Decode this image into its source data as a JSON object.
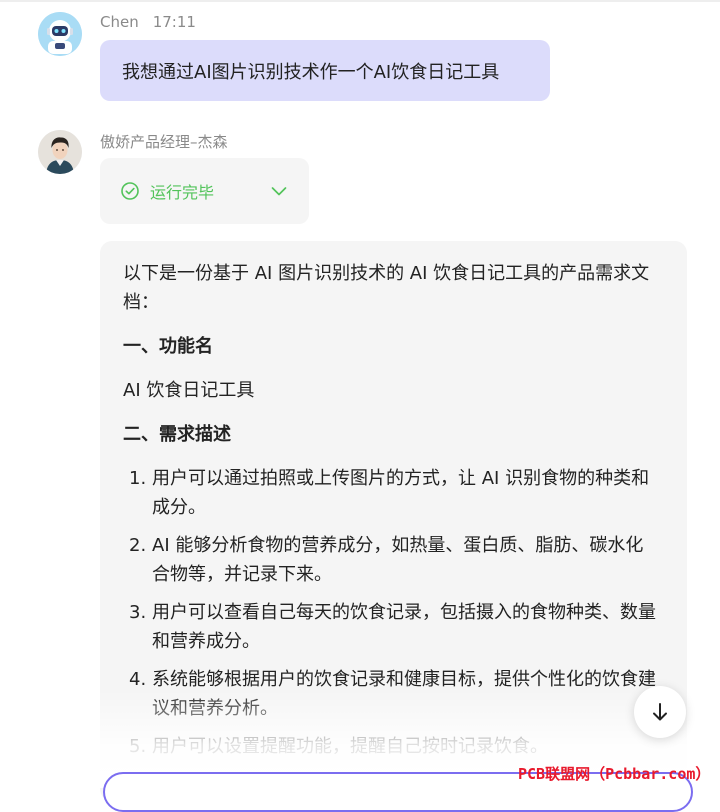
{
  "user_message": {
    "name": "Chen",
    "time": "17:11",
    "text": "我想通过AI图片识别技术作一个AI饮食日记工具",
    "avatar_icon": "robot-avatar"
  },
  "bot_message": {
    "name": "傲娇产品经理–杰森",
    "avatar_icon": "person-avatar",
    "status": {
      "label": "运行完毕",
      "icon": "check-circle-icon",
      "color": "#52c35a"
    },
    "content": {
      "intro": "以下是一份基于 AI 图片识别技术的 AI 饮食日记工具的产品需求文档：",
      "section1_title": "一、功能名",
      "section1_body": "AI 饮食日记工具",
      "section2_title": "二、需求描述",
      "items": [
        {
          "num": "1.",
          "text": "用户可以通过拍照或上传图片的方式，让 AI 识别食物的种类和成分。"
        },
        {
          "num": "2.",
          "text": "AI 能够分析食物的营养成分，如热量、蛋白质、脂肪、碳水化合物等，并记录下来。"
        },
        {
          "num": "3.",
          "text": "用户可以查看自己每天的饮食记录，包括摄入的食物种类、数量和营养成分。"
        },
        {
          "num": "4.",
          "text": "系统能够根据用户的饮食记录和健康目标，提供个性化的饮食建议和营养分析。"
        },
        {
          "num": "5.",
          "text": "用户可以设置提醒功能，提醒自己按时记录饮食。"
        }
      ]
    }
  },
  "controls": {
    "scroll_down_icon": "arrow-down-icon"
  },
  "watermark": "PCB联盟网（Pcbbar.com）",
  "colors": {
    "user_bubble": "#dcdcfb",
    "accent": "#7b6df0",
    "watermark": "#e8192c"
  }
}
